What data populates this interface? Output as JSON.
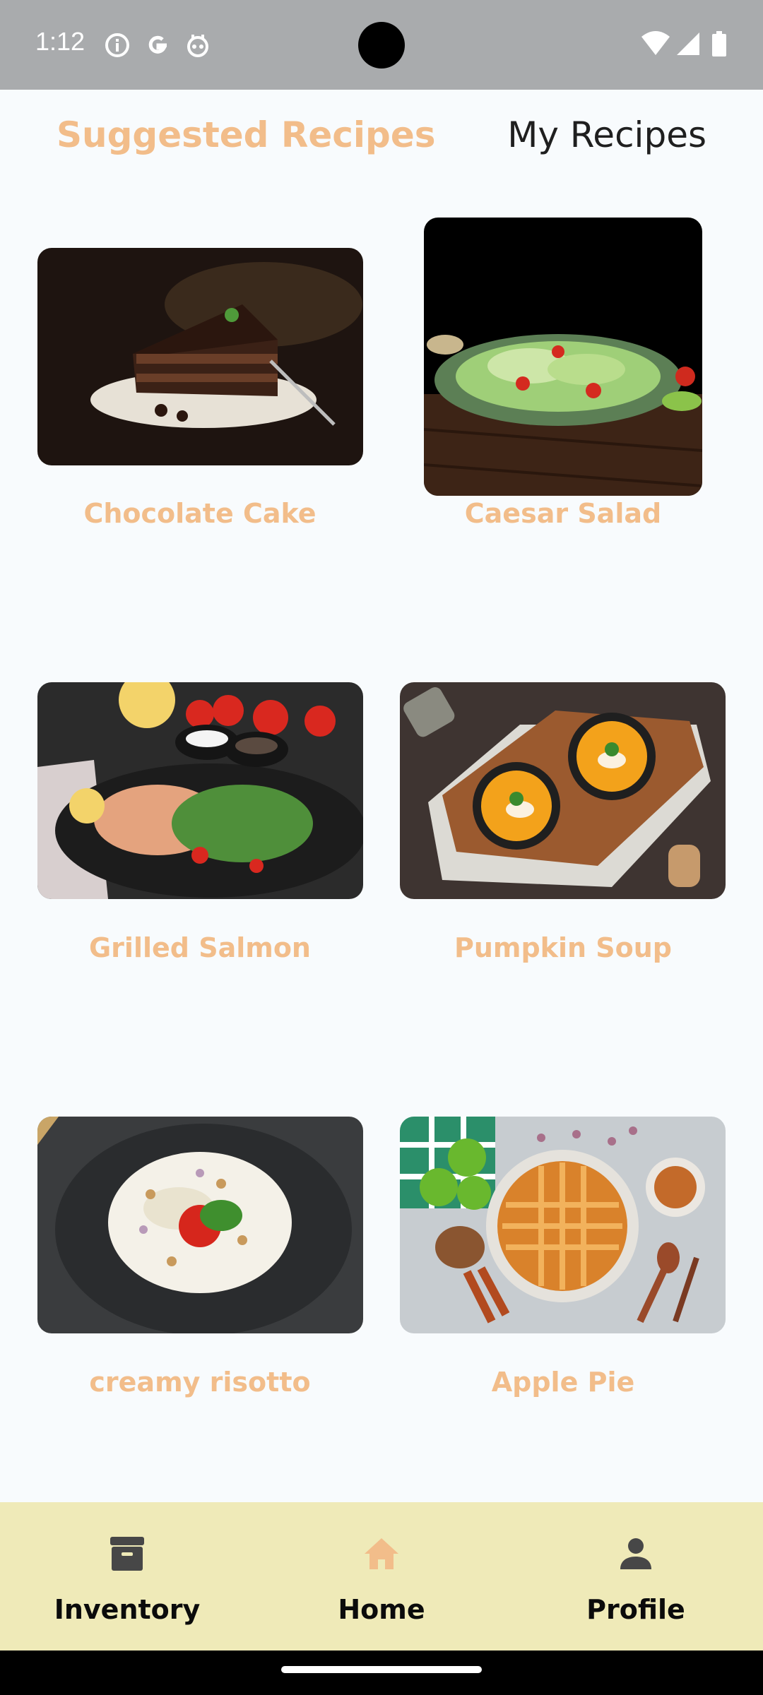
{
  "status_bar": {
    "time": "1:12",
    "icons": [
      "info-icon",
      "google-icon",
      "robot-icon",
      "wifi-icon",
      "signal-icon",
      "battery-icon"
    ]
  },
  "tabs": {
    "suggested": "Suggested Recipes",
    "mine": "My Recipes",
    "active": "suggested",
    "active_color": "#f2bd8a"
  },
  "recipes": [
    {
      "name": "Chocolate Cake",
      "image": "chocolate-cake-photo"
    },
    {
      "name": "Caesar Salad",
      "image": "caesar-salad-photo"
    },
    {
      "name": "Grilled Salmon",
      "image": "grilled-salmon-photo"
    },
    {
      "name": "Pumpkin Soup",
      "image": "pumpkin-soup-photo"
    },
    {
      "name": "creamy risotto",
      "image": "creamy-risotto-photo"
    },
    {
      "name": "Apple Pie",
      "image": "apple-pie-photo"
    }
  ],
  "bottom_nav": {
    "items": [
      {
        "label": "Inventory",
        "icon": "archive-box-icon"
      },
      {
        "label": "Home",
        "icon": "home-icon"
      },
      {
        "label": "Profile",
        "icon": "person-icon"
      }
    ],
    "active": "Home",
    "background": "#efeab8"
  }
}
